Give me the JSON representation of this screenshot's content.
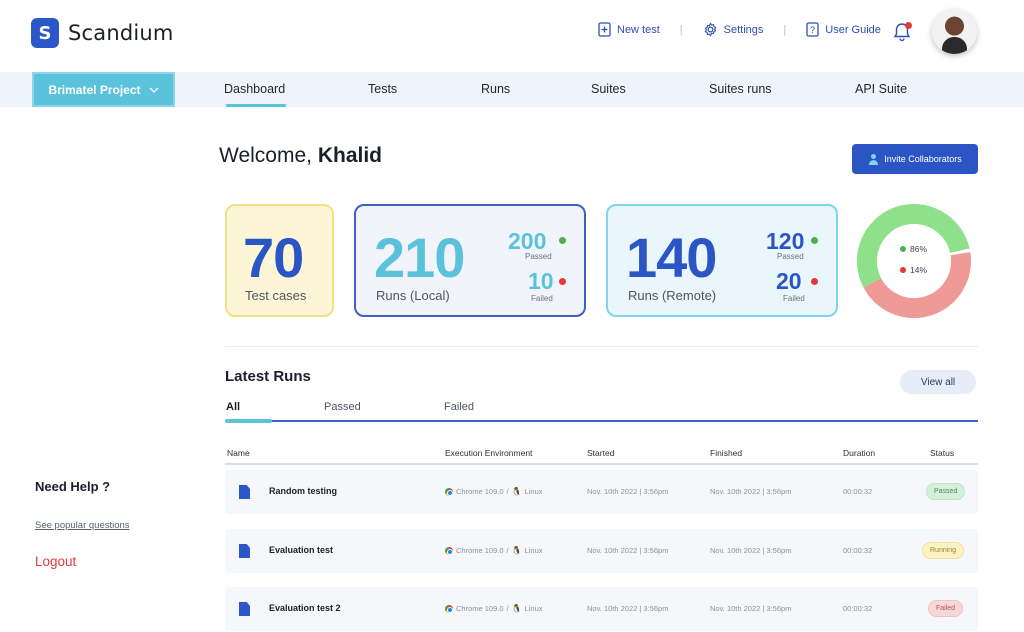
{
  "app": {
    "name": "Scandium",
    "logo_letter": "S"
  },
  "top_actions": {
    "new_test": "New test",
    "settings": "Settings",
    "user_guide": "User Guide",
    "separator": "|"
  },
  "project": {
    "name": "Brimatel Project"
  },
  "nav": {
    "tabs": [
      "Dashboard",
      "Tests",
      "Runs",
      "Suites",
      "Suites runs",
      "API Suite"
    ],
    "active": "Dashboard"
  },
  "welcome": {
    "greeting": "Welcome,",
    "user": "Khalid"
  },
  "invite_label": "Invite Collaborators",
  "stats": {
    "test_cases": {
      "value": "70",
      "label": "Test cases"
    },
    "local": {
      "value": "210",
      "label": "Runs (Local)",
      "passed": "200",
      "passed_label": "Passed",
      "failed": "10",
      "failed_label": "Failed"
    },
    "remote": {
      "value": "140",
      "label": "Runs (Remote)",
      "passed": "120",
      "passed_label": "Passed",
      "failed": "20",
      "failed_label": "Failed"
    }
  },
  "donut": {
    "pass_pct": "86%",
    "fail_pct": "14%",
    "pass_value": 86,
    "fail_value": 14,
    "pass_color": "#8ee08a",
    "fail_color": "#ef9a96"
  },
  "latest_runs": {
    "title": "Latest Runs",
    "view_all": "View all",
    "filters": [
      "All",
      "Passed",
      "Failed"
    ],
    "columns": [
      "Name",
      "Execution Environment",
      "Started",
      "Finished",
      "Duration",
      "Status"
    ],
    "rows": [
      {
        "name": "Random testing",
        "browser": "Chrome 109.0",
        "os": "Linux",
        "started": "Nov. 10th 2022  |  3:56pm",
        "finished": "Nov. 10th 2022  |  3:56pm",
        "duration": "00:00:32",
        "status": "Passed"
      },
      {
        "name": "Evaluation test",
        "browser": "Chrome 109.0",
        "os": "Linux",
        "started": "Nov. 10th 2022  |  3:56pm",
        "finished": "Nov. 10th 2022  |  3:56pm",
        "duration": "00:00:32",
        "status": "Running"
      },
      {
        "name": "Evaluation test 2",
        "browser": "Chrome 109.0",
        "os": "Linux",
        "started": "Nov. 10th 2022  |  3:56pm",
        "finished": "Nov. 10th 2022  |  3:56pm",
        "duration": "00:00:32",
        "status": "Failed"
      }
    ]
  },
  "sidebar": {
    "need_help": "Need Help ?",
    "popular": "See popular questions",
    "logout": "Logout"
  },
  "colors": {
    "primary": "#2b57c9",
    "accent": "#5bc2dc",
    "danger": "#e53935",
    "success": "#4caf50"
  }
}
